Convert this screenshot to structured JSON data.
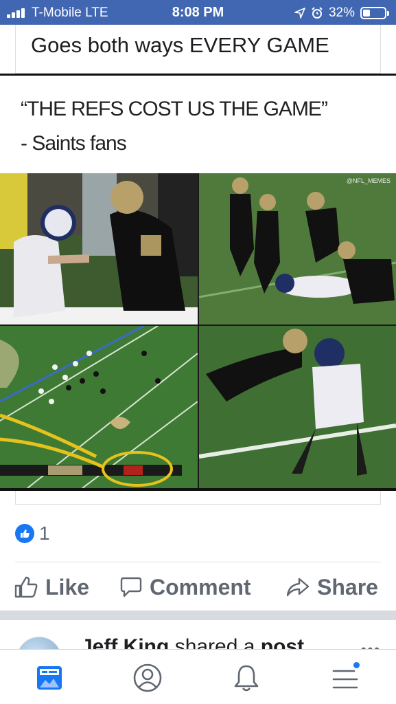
{
  "status_bar": {
    "carrier": "T-Mobile  LTE",
    "time": "8:08 PM",
    "battery_text": "32%",
    "battery_level": 0.32,
    "icons": [
      "signal-bars-icon",
      "location-arrow-icon",
      "alarm-icon",
      "battery-icon"
    ]
  },
  "post": {
    "caption": "Goes both ways EVERY GAME",
    "meme": {
      "line1": "“THE REFS COST US THE GAME”",
      "line2": "- Saints fans",
      "watermark": "@NFL_MEMES"
    },
    "reactions": {
      "icon": "thumbs-up-icon",
      "count": "1"
    },
    "actions": {
      "like": "Like",
      "comment": "Comment",
      "share": "Share"
    }
  },
  "next_post": {
    "author": "Jeff King",
    "action_text": "shared a",
    "object_text": "post",
    "more_icon": "more-dots-icon"
  },
  "bottom_nav": {
    "items": [
      "news-feed-icon",
      "profile-icon",
      "notifications-bell-icon",
      "menu-icon"
    ],
    "accent": "#1877f2"
  },
  "colors": {
    "header_blue": "#4267b2",
    "action_gray": "#606770",
    "divider": "#dddfe2"
  }
}
